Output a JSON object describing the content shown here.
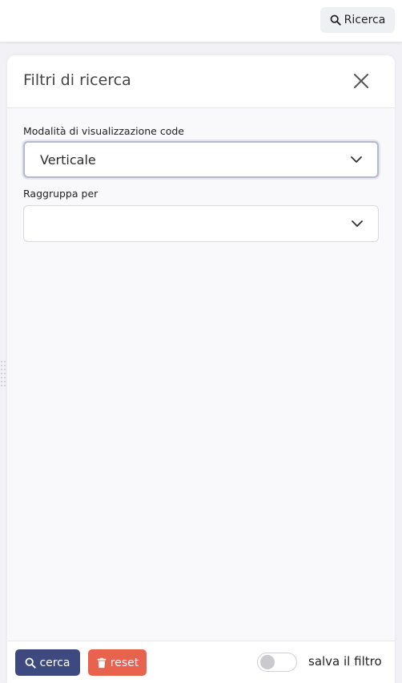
{
  "topbar": {
    "search_button_label": "Ricerca",
    "search_icon": "magnifier-icon"
  },
  "panel": {
    "title": "Filtri di ricerca",
    "close_icon": "close-icon"
  },
  "fields": {
    "queue_view_mode": {
      "label": "Modalità di visualizzazione code",
      "value": "Verticale"
    },
    "group_by": {
      "label": "Raggruppa per",
      "value": ""
    }
  },
  "footer": {
    "search_button": "cerca",
    "reset_button": "reset",
    "save_filter_label": "salva il filtro",
    "save_filter_enabled": false
  },
  "colors": {
    "search_button_bg": "#3e4a7f",
    "reset_button_bg": "#e8624e",
    "page_bg": "#f1f1f6"
  }
}
